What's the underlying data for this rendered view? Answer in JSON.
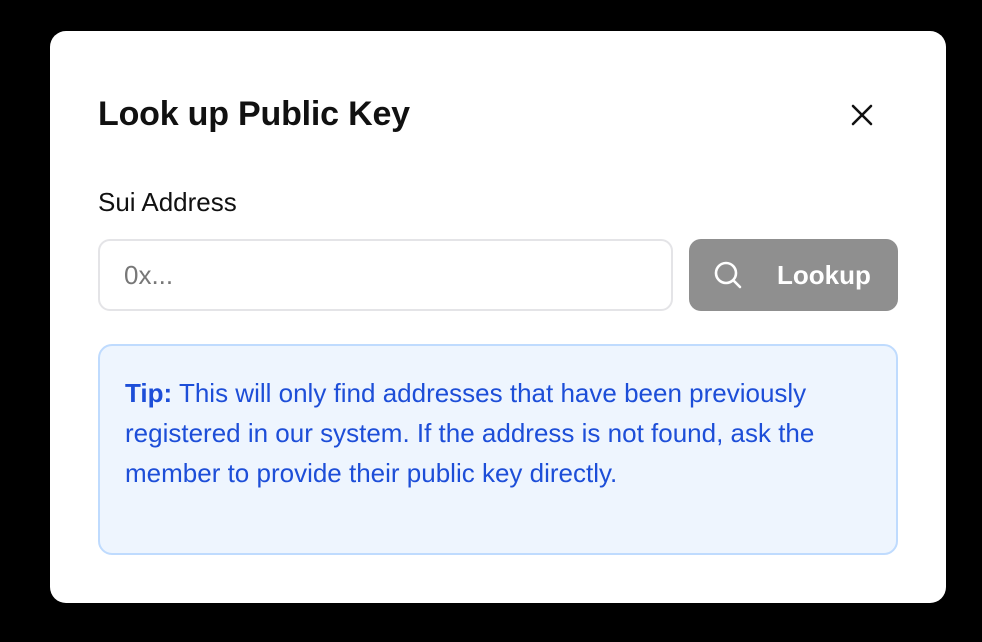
{
  "dialog": {
    "title": "Look up Public Key",
    "close_icon": "close-icon"
  },
  "address_field": {
    "label": "Sui Address",
    "value": "",
    "placeholder": "0x..."
  },
  "lookup_button": {
    "label": "Lookup",
    "icon": "search-icon"
  },
  "tip": {
    "prefix": "Tip:",
    "text": "This will only find addresses that have been previously registered in our system. If the address is not found, ask the member to provide their public key directly."
  },
  "colors": {
    "backdrop": "#000000",
    "dialog_bg": "#ffffff",
    "button_disabled_bg": "#8f8f8f",
    "tip_bg": "#eef5fe",
    "tip_border": "#bfdbfe",
    "tip_text": "#1d4ed8"
  }
}
